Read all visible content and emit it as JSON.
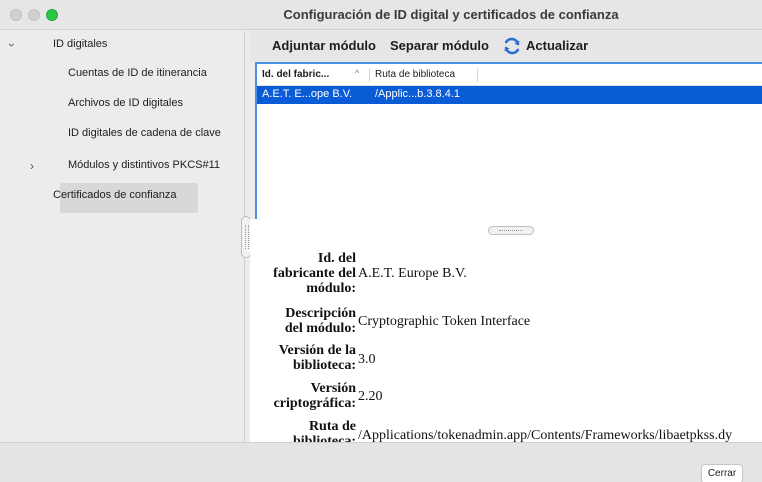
{
  "window": {
    "title": "Configuración de ID digital y certificados de confianza"
  },
  "sidebar": {
    "items": [
      {
        "label": "ID digitales",
        "expanded": true
      },
      {
        "label": "Cuentas de ID de itinerancia"
      },
      {
        "label": "Archivos de ID digitales"
      },
      {
        "label": "ID digitales de cadena de clave"
      },
      {
        "label": "Módulos y distintivos PKCS#11",
        "selected": true,
        "collapsed": true
      },
      {
        "label": "Certificados de confianza"
      }
    ]
  },
  "toolbar": {
    "attach_label": "Adjuntar módulo",
    "detach_label": "Separar módulo",
    "refresh_label": "Actualizar"
  },
  "table": {
    "columns": [
      "Id. del fabric...",
      "Ruta de biblioteca"
    ],
    "rows": [
      [
        "A.E.T. E...ope B.V.",
        "/Applic...b.3.8.4.1"
      ]
    ]
  },
  "details": [
    {
      "label": "Id. del fabricante del módulo:",
      "value": "A.E.T. Europe B.V."
    },
    {
      "label": "Descripción del módulo:",
      "value": "Cryptographic Token Interface"
    },
    {
      "label": "Versión de la biblioteca:",
      "value": "3.0"
    },
    {
      "label": "Versión criptográfica:",
      "value": "2.20"
    },
    {
      "label": "Ruta de biblioteca:",
      "value": "/Applications/tokenadmin.app/Contents/Frameworks/libaetpkss.dy"
    }
  ],
  "footer": {
    "close_label": "Cerrar"
  },
  "colors": {
    "selection": "#0a5cd6",
    "focus_ring": "#4a90e2",
    "traffic_green": "#2ac845"
  }
}
